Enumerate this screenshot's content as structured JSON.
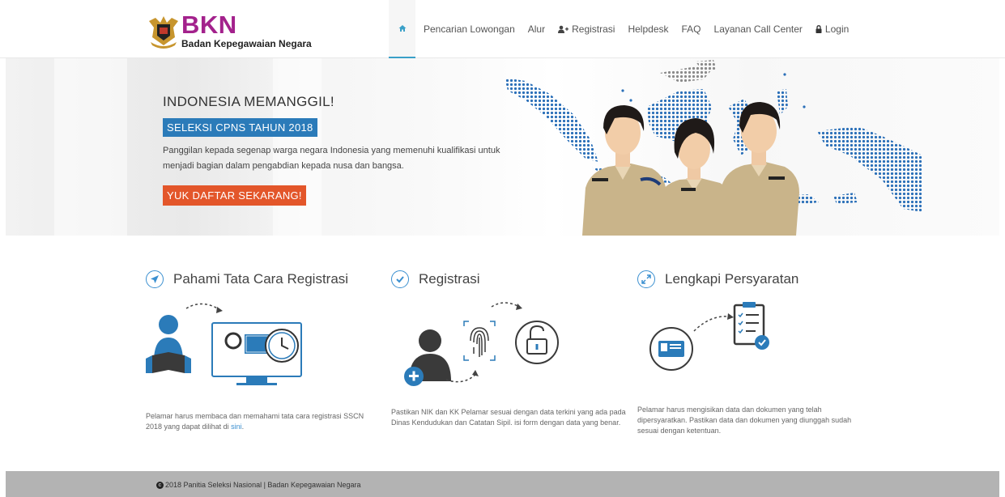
{
  "brand": {
    "title": "BKN",
    "subtitle": "Badan Kepegawaian Negara"
  },
  "nav": {
    "items": [
      {
        "label": "Pencarian Lowongan",
        "icon": "none"
      },
      {
        "label": "Alur",
        "icon": "none"
      },
      {
        "label": "Registrasi",
        "icon": "user-plus-icon"
      },
      {
        "label": "Helpdesk",
        "icon": "none"
      },
      {
        "label": "FAQ",
        "icon": "none"
      },
      {
        "label": "Layanan Call Center",
        "icon": "none"
      },
      {
        "label": "Login",
        "icon": "lock-icon"
      }
    ],
    "home_icon": "home-icon",
    "active": "home"
  },
  "hero": {
    "kicker": "INDONESIA MEMANGGIL!",
    "badge": "SELEKSI CPNS TAHUN 2018",
    "description": "Panggilan kepada segenap warga negara Indonesia yang memenuhi kualifikasi untuk menjadi bagian dalam pengabdian kepada nusa dan bangsa.",
    "cta": "YUK DAFTAR SEKARANG!"
  },
  "features": [
    {
      "title": "Pahami Tata Cara Registrasi",
      "icon": "send-icon",
      "text": "Pelamar harus membaca dan memahami tata cara registrasi SSCN 2018 yang dapat dilihat di ",
      "link": "sini",
      "text_end": "."
    },
    {
      "title": "Registrasi",
      "icon": "check-icon",
      "text": "Pastikan NIK dan KK Pelamar sesuai dengan data terkini yang ada pada Dinas Kendudukan dan Catatan Sipil. isi form dengan data yang benar."
    },
    {
      "title": "Lengkapi Persyaratan",
      "icon": "expand-icon",
      "text": "Pelamar harus mengisikan data dan dokumen yang telah dipersyaratkan. Pastikan data dan dokumen yang diunggah sudah sesuai dengan ketentuan."
    }
  ],
  "footer": {
    "text": "2018 Panitia Seleksi Nasional | Badan Kepegawaian Negara"
  },
  "colors": {
    "brand": "#a3218c",
    "accent": "#2b7bb9",
    "cta": "#e3562a",
    "footer": "#b3b3b3"
  }
}
